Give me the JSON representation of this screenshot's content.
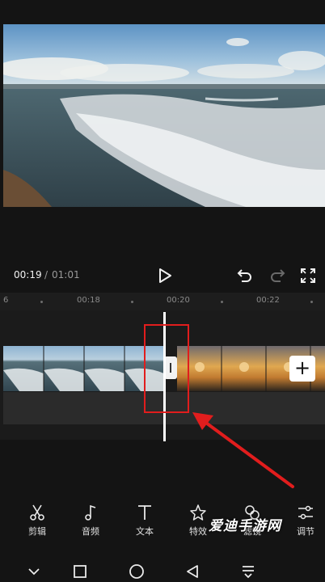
{
  "player": {
    "current_time": "00:19",
    "separator": "/",
    "total_time": "01:01"
  },
  "controls": {
    "play": "play-icon",
    "undo": "undo-icon",
    "redo": "redo-icon",
    "fullscreen": "fullscreen-icon"
  },
  "ruler": {
    "ticks": [
      "6",
      "00:18",
      "00:20",
      "00:22"
    ]
  },
  "timeline": {
    "add_clip_label": "+"
  },
  "toolbar": {
    "items": [
      {
        "label": "剪辑",
        "icon": "scissors-icon"
      },
      {
        "label": "音频",
        "icon": "music-note-icon"
      },
      {
        "label": "文本",
        "icon": "text-icon"
      },
      {
        "label": "特效",
        "icon": "sparkle-star-icon"
      },
      {
        "label": "滤镜",
        "icon": "filter-icon"
      },
      {
        "label": "调节",
        "icon": "sliders-icon"
      }
    ]
  },
  "watermark": "爱迪手游网",
  "nav": [
    "chevron-down-icon",
    "square-icon",
    "circle-icon",
    "back-triangle-icon",
    "menu-down-icon"
  ],
  "colors": {
    "background": "#141414",
    "highlight_red": "#e11d1d",
    "playhead": "#ffffff"
  }
}
